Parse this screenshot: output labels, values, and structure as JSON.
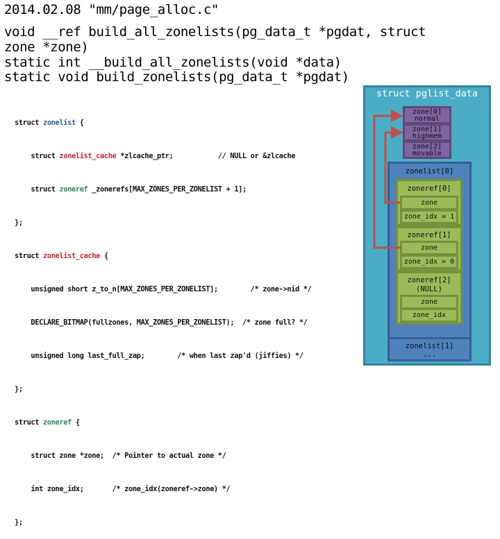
{
  "header": {
    "title": "2014.02.08 \"mm/page_alloc.c\"",
    "signatures": [
      "void __ref build_all_zonelists(pg_data_t *pgdat, struct",
      "zone *zone)",
      "static int __build_all_zonelists(void *data)",
      "static void build_zonelists(pg_data_t *pgdat)"
    ]
  },
  "code": {
    "zonelist": {
      "l1_a": "struct ",
      "l1_b": "zonelist",
      "l1_c": " {",
      "l2_a": "    struct ",
      "l2_b": "zonelist_cache",
      "l2_c": " *zlcache_ptr;           // NULL or &zlcache",
      "l3_a": "    struct ",
      "l3_b": "zoneref",
      "l3_c": " _zonerefs[MAX_ZONES_PER_ZONELIST + 1];",
      "l4": "};"
    },
    "zonelist_cache": {
      "l1_a": "struct ",
      "l1_b": "zonelist_cache",
      "l1_c": " {",
      "l2": "    unsigned short z_to_n[MAX_ZONES_PER_ZONELIST];        /* zone->nid */",
      "l3": "    DECLARE_BITMAP(fullzones, MAX_ZONES_PER_ZONELIST);  /* zone full? */",
      "l4": "    unsigned long last_full_zap;        /* when last zap'd (jiffies) */",
      "l5": "};"
    },
    "zoneref": {
      "l1_a": "struct ",
      "l1_b": "zoneref",
      "l1_c": " {",
      "l2": "    struct zone *zone;  /* Pointer to actual zone */",
      "l3": "    int zone_idx;       /* zone_idx(zoneref->zone) */",
      "l4": "};"
    }
  },
  "diagram": {
    "outer_title": "struct pglist_data",
    "zones": [
      {
        "name": "zone[0]",
        "type": "normal"
      },
      {
        "name": "zone[1]",
        "type": "highmem"
      },
      {
        "name": "zone[2]",
        "type": "movable"
      }
    ],
    "zonelist0": {
      "label": "zonelist[0]",
      "zonerefs": [
        {
          "label": "zoneref[0]",
          "sub": "",
          "zone": "zone",
          "idx": "zone_idx = 1"
        },
        {
          "label": "zoneref[1]",
          "sub": "",
          "zone": "zone",
          "idx": "zone_idx = 0"
        },
        {
          "label": "zoneref[2]",
          "sub": "(NULL)",
          "zone": "zone",
          "idx": "zone_idx"
        }
      ]
    },
    "zonelist1": {
      "label": "zonelist[1]",
      "ellipsis": "..."
    },
    "colors": {
      "outer": "#4bacc6",
      "zone": "#8064a2",
      "zonelist": "#4f81bd",
      "zoneref": "#9bbb59",
      "arrow": "#c0504d"
    }
  }
}
